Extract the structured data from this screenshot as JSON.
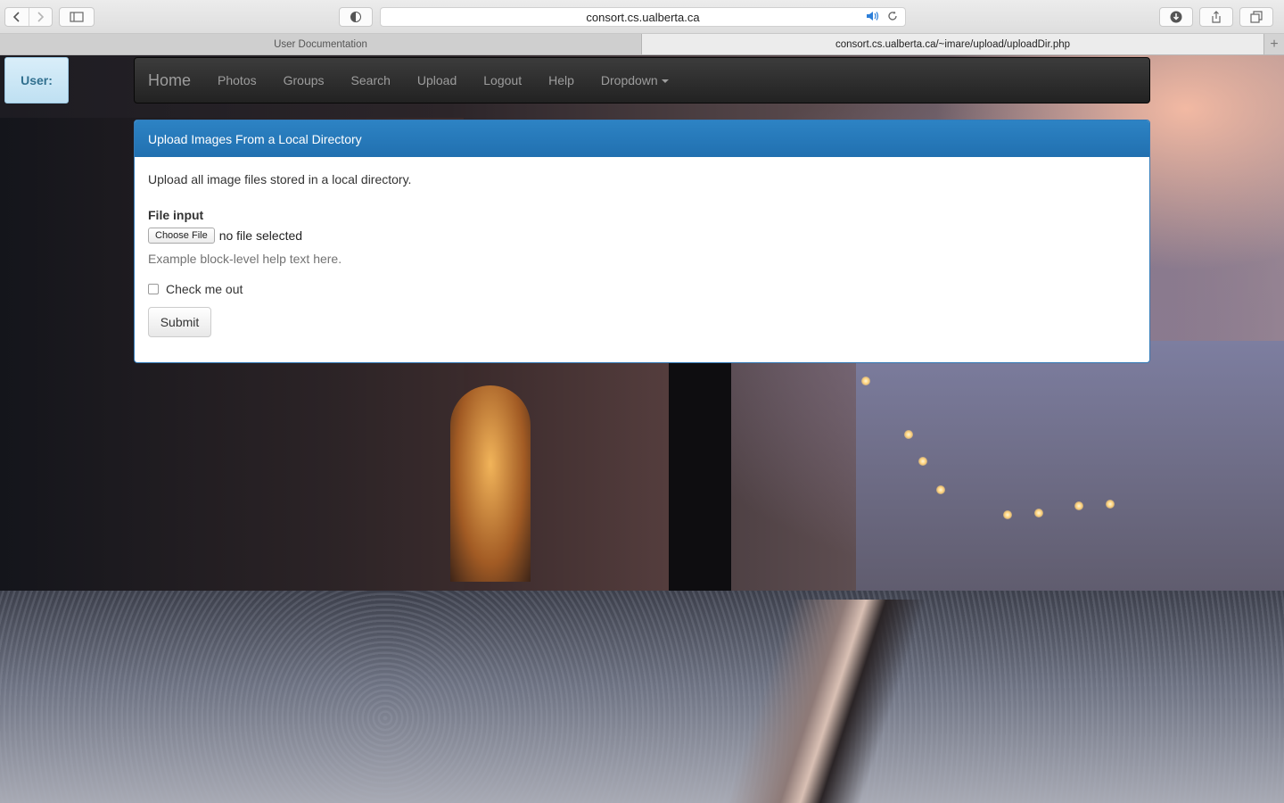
{
  "browser": {
    "url": "consort.cs.ualberta.ca",
    "tabs": [
      {
        "label": "User Documentation",
        "active": false
      },
      {
        "label": "consort.cs.ualberta.ca/~imare/upload/uploadDir.php",
        "active": true
      }
    ]
  },
  "user_badge": {
    "label": "User:"
  },
  "navbar": {
    "brand": "Home",
    "items": [
      "Photos",
      "Groups",
      "Search",
      "Upload",
      "Logout",
      "Help"
    ],
    "dropdown": "Dropdown"
  },
  "panel": {
    "title": "Upload Images From a Local Directory",
    "intro": "Upload all image files stored in a local directory.",
    "file_label": "File input",
    "file_button": "Choose File",
    "file_status": "no file selected",
    "help_text": "Example block-level help text here.",
    "checkbox_label": "Check me out",
    "checkbox_checked": false,
    "submit_label": "Submit"
  },
  "colors": {
    "panel_primary": "#337ab7",
    "navbar_bg": "#222222",
    "user_badge_bg": "#d9edf7"
  }
}
